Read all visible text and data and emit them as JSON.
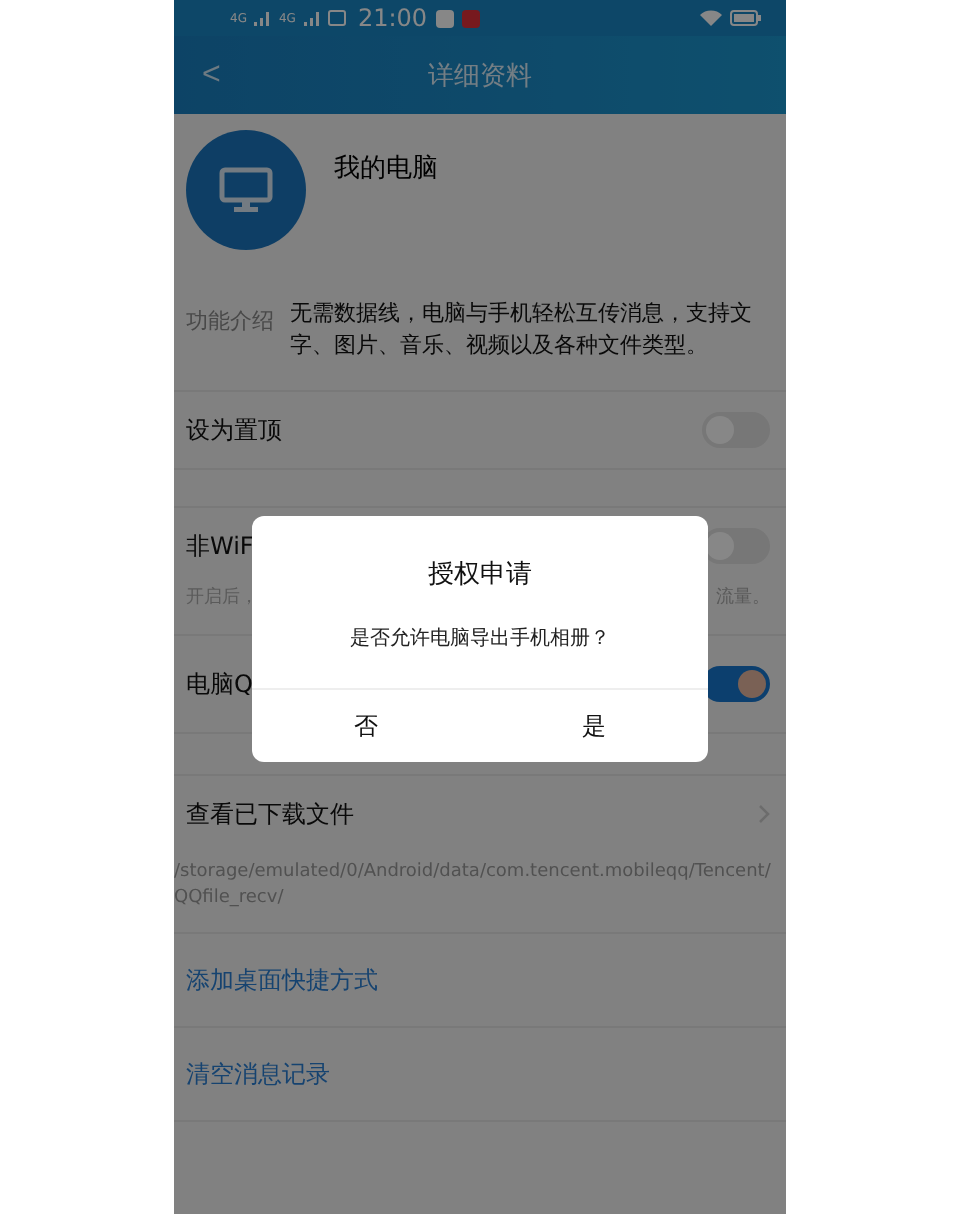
{
  "status_bar": {
    "network_1": "4G",
    "network_2": "4G",
    "time": "21:00"
  },
  "nav": {
    "back": "<",
    "title": "详细资料"
  },
  "profile": {
    "name": "我的电脑"
  },
  "intro": {
    "label": "功能介绍",
    "text": "无需数据线，电脑与手机轻松互传消息，支持文字、图片、音乐、视频以及各种文件类型。"
  },
  "settings": [
    {
      "label": "设为置顶",
      "on": false
    },
    {
      "label": "非WiF",
      "on": false,
      "note_left": "开启后，",
      "note_right": "流量。"
    },
    {
      "label": "电脑Q",
      "on": true
    }
  ],
  "downloads": {
    "label": "查看已下载文件",
    "path": "/storage/emulated/0/Android/data/com.tencent.mobileqq/Tencent/QQfile_recv/"
  },
  "links": [
    "添加桌面快捷方式",
    "清空消息记录"
  ],
  "dialog": {
    "title": "授权申请",
    "message": "是否允许电脑导出手机相册？",
    "buttons": [
      "否",
      "是"
    ]
  }
}
